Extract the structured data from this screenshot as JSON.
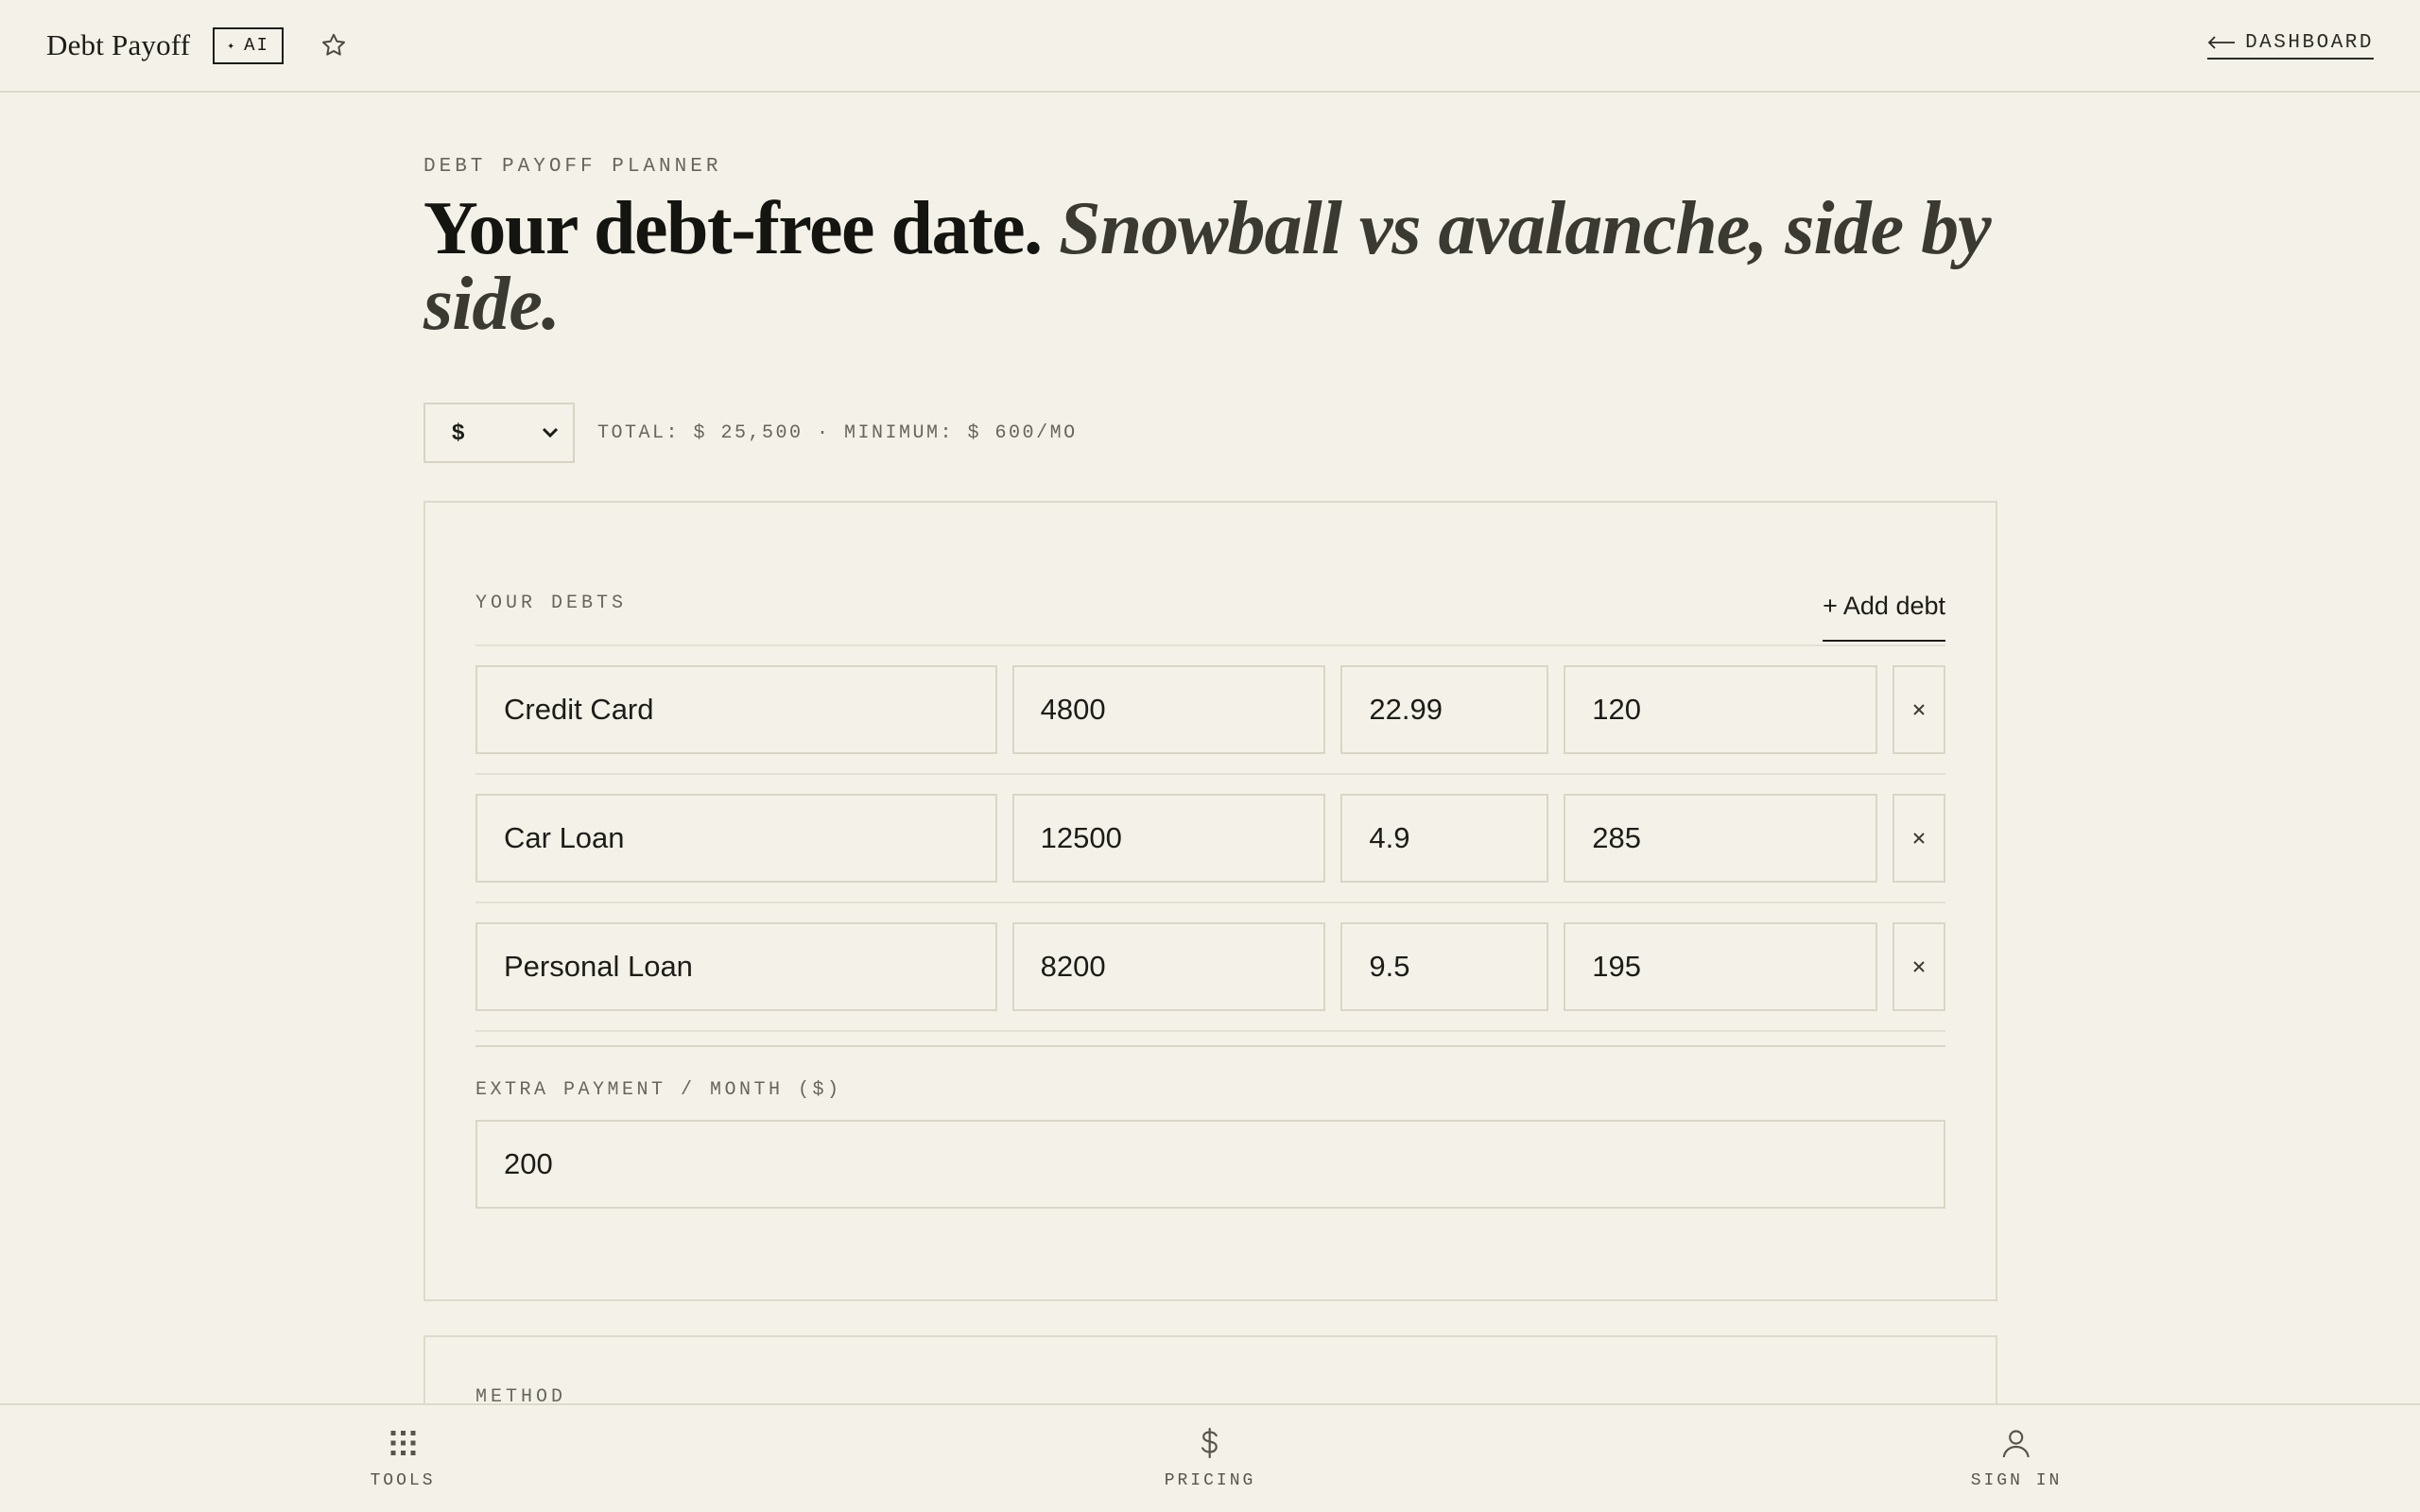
{
  "header": {
    "app_title": "Debt Payoff",
    "ai_badge": "AI",
    "dashboard_link": "DASHBOARD"
  },
  "page": {
    "eyebrow": "DEBT PAYOFF PLANNER",
    "headline_main": "Your debt-free date.",
    "headline_italic": "Snowball vs avalanche, side by side."
  },
  "currency": {
    "selected": "$",
    "totals": "TOTAL: $ 25,500 · MINIMUM: $ 600/MO"
  },
  "debts": {
    "section_label": "YOUR DEBTS",
    "add_label": "+ Add debt",
    "rows": [
      {
        "name": "Credit Card",
        "balance": "4800",
        "rate": "22.99",
        "minimum": "120"
      },
      {
        "name": "Car Loan",
        "balance": "12500",
        "rate": "4.9",
        "minimum": "285"
      },
      {
        "name": "Personal Loan",
        "balance": "8200",
        "rate": "9.5",
        "minimum": "195"
      }
    ],
    "remove_symbol": "×"
  },
  "extra": {
    "label": "EXTRA PAYMENT / MONTH ($)",
    "value": "200"
  },
  "method": {
    "label": "METHOD"
  },
  "bottom_nav": {
    "tools": "TOOLS",
    "pricing": "PRICING",
    "sign_in": "SIGN IN"
  },
  "colors": {
    "background": "#f4f2e8",
    "text": "#1c1c18",
    "muted": "#67665c",
    "border": "#d9d6c6"
  }
}
